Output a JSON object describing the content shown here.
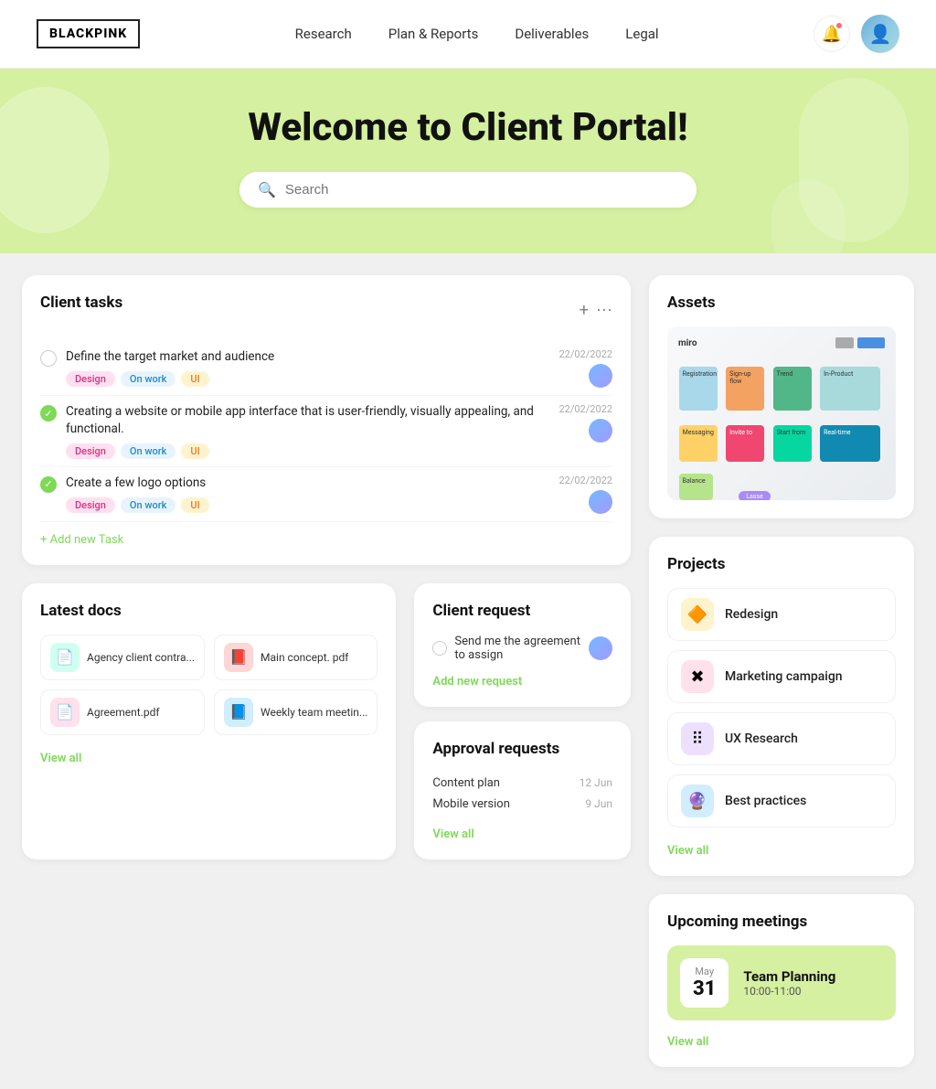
{
  "header": {
    "logo": "BLACKPINK",
    "nav": [
      {
        "label": "Research",
        "id": "research"
      },
      {
        "label": "Plan & Reports",
        "id": "plan-reports"
      },
      {
        "label": "Deliverables",
        "id": "deliverables"
      },
      {
        "label": "Legal",
        "id": "legal"
      }
    ]
  },
  "hero": {
    "title": "Welcome to Client Portal!",
    "search_placeholder": "Search"
  },
  "client_tasks": {
    "title": "Client tasks",
    "tasks": [
      {
        "text": "Define the target market and audience",
        "checked": false,
        "tags": [
          "Design",
          "On work",
          "UI"
        ],
        "date": "22/02/2022"
      },
      {
        "text": "Creating a website or mobile app interface that is user-friendly, visually appealing, and functional.",
        "checked": true,
        "tags": [
          "Design",
          "On work",
          "UI"
        ],
        "date": "22/02/2022"
      },
      {
        "text": "Create a few logo options",
        "checked": true,
        "tags": [
          "Design",
          "On work",
          "UI"
        ],
        "date": "22/02/2022"
      }
    ],
    "add_label": "+ Add new Task"
  },
  "assets": {
    "title": "Assets"
  },
  "latest_docs": {
    "title": "Latest docs",
    "docs": [
      {
        "name": "Agency client contra...",
        "color": "#20c997",
        "icon": "📄"
      },
      {
        "name": "Main concept. pdf",
        "color": "#ff6b6b",
        "icon": "📕"
      },
      {
        "name": "Agreement.pdf",
        "color": "#f06595",
        "icon": "📄"
      },
      {
        "name": "Weekly team meetin...",
        "color": "#74c0fc",
        "icon": "📘"
      }
    ],
    "view_all": "View all"
  },
  "projects": {
    "title": "Projects",
    "items": [
      {
        "name": "Redesign",
        "icon": "🔶",
        "color": "#ffd43b"
      },
      {
        "name": "Marketing campaign",
        "icon": "✖",
        "color": "#f06595"
      },
      {
        "name": "UX Research",
        "icon": "⠿",
        "color": "#a78bfa"
      },
      {
        "name": "Best practices",
        "icon": "🔮",
        "color": "#74b9ff"
      }
    ],
    "view_all": "View all"
  },
  "client_request": {
    "title": "Client request",
    "request_text": "Send me the agreement to assign",
    "add_label": "Add new request"
  },
  "approval_requests": {
    "title": "Approval requests",
    "items": [
      {
        "name": "Content plan",
        "date": "12 Jun"
      },
      {
        "name": "Mobile version",
        "date": "9 Jun"
      }
    ],
    "view_all": "View all"
  },
  "upcoming_meetings": {
    "title": "Upcoming meetings",
    "meeting": {
      "month": "May",
      "day": "31",
      "name": "Team Planning",
      "time": "10:00-11:00"
    },
    "view_all": "View all"
  }
}
